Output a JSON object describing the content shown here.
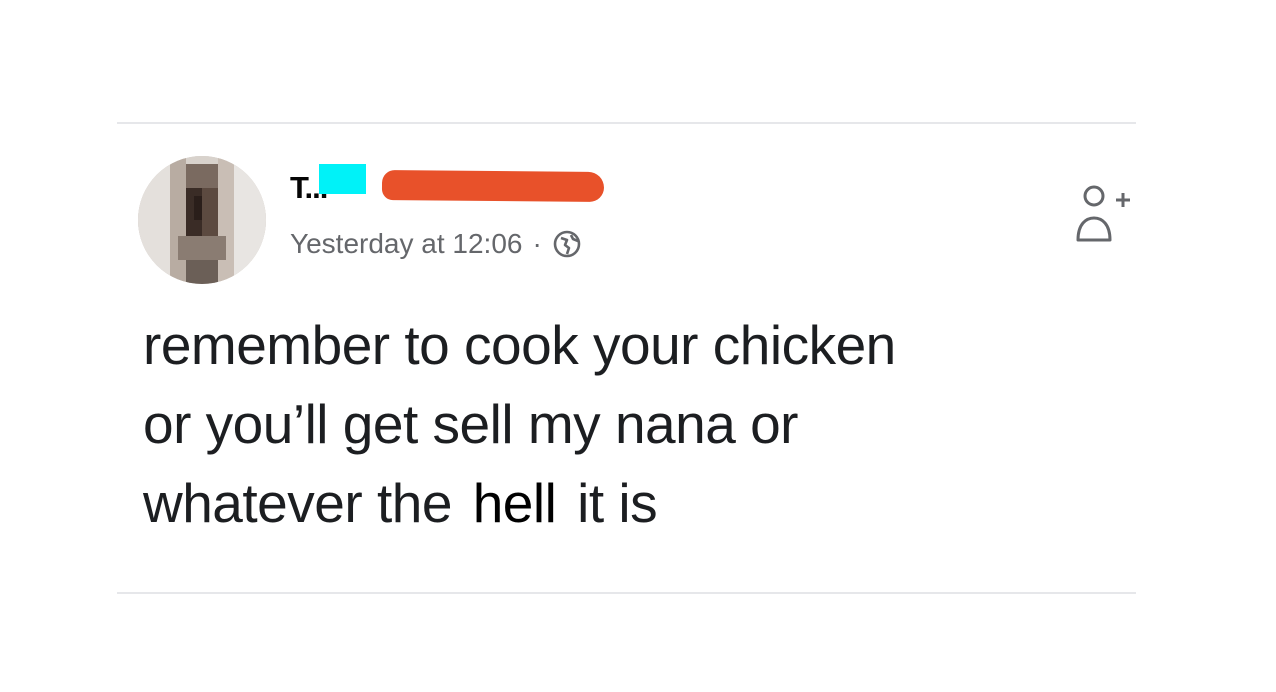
{
  "post": {
    "author_visible": "T...",
    "timestamp": "Yesterday at 12:06",
    "separator": "·",
    "privacy_icon": "globe-icon",
    "action_icon": "add-friend-icon",
    "text_lines": [
      {
        "before": "remember to cook your chicken",
        "emph": "",
        "after": ""
      },
      {
        "before": "or you’ll get sell my nana or",
        "emph": "",
        "after": ""
      },
      {
        "before": "whatever the",
        "emph": "hell",
        "after": "it is"
      }
    ]
  },
  "redaction_colors": {
    "cyan": "#00f2f8",
    "orange": "#e8512a"
  }
}
